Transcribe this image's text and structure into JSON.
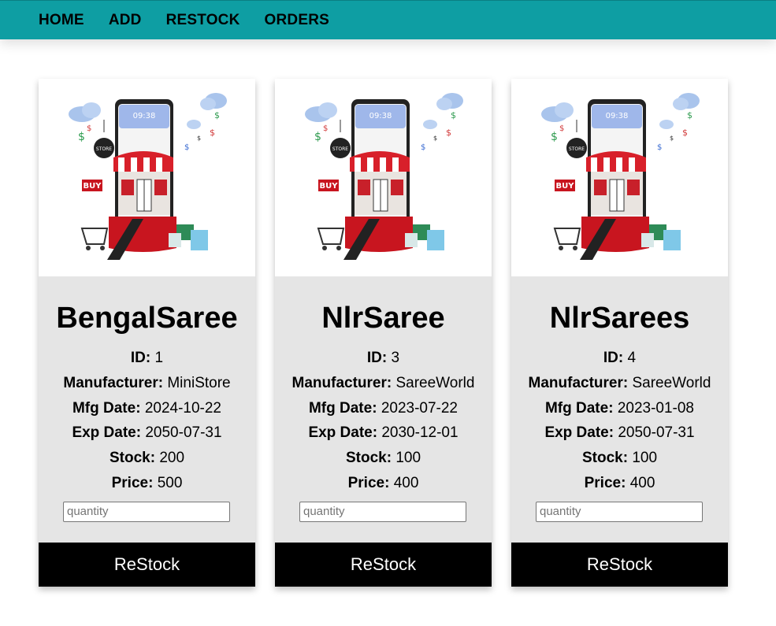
{
  "nav": {
    "items": [
      "HOME",
      "ADD",
      "RESTOCK",
      "ORDERS"
    ]
  },
  "labels": {
    "id": "ID:",
    "manufacturer": "Manufacturer:",
    "mfg_date": "Mfg Date:",
    "exp_date": "Exp Date:",
    "stock": "Stock:",
    "price": "Price:",
    "quantity_placeholder": "quantity",
    "restock_button": "ReStock"
  },
  "image": {
    "screen_time": "09:38",
    "store_sign": "STORE",
    "buy_tag": "BUY"
  },
  "products": [
    {
      "name": "BengalSaree",
      "id": "1",
      "manufacturer": "MiniStore",
      "mfg_date": "2024-10-22",
      "exp_date": "2050-07-31",
      "stock": "200",
      "price": "500"
    },
    {
      "name": "NlrSaree",
      "id": "3",
      "manufacturer": "SareeWorld",
      "mfg_date": "2023-07-22",
      "exp_date": "2030-12-01",
      "stock": "100",
      "price": "400"
    },
    {
      "name": "NlrSarees",
      "id": "4",
      "manufacturer": "SareeWorld",
      "mfg_date": "2023-01-08",
      "exp_date": "2050-07-31",
      "stock": "100",
      "price": "400"
    }
  ],
  "colors": {
    "navbar": "#0e9ea3",
    "card_bg": "#e5e5e5",
    "button_bg": "#000000",
    "button_text": "#ffffff"
  }
}
